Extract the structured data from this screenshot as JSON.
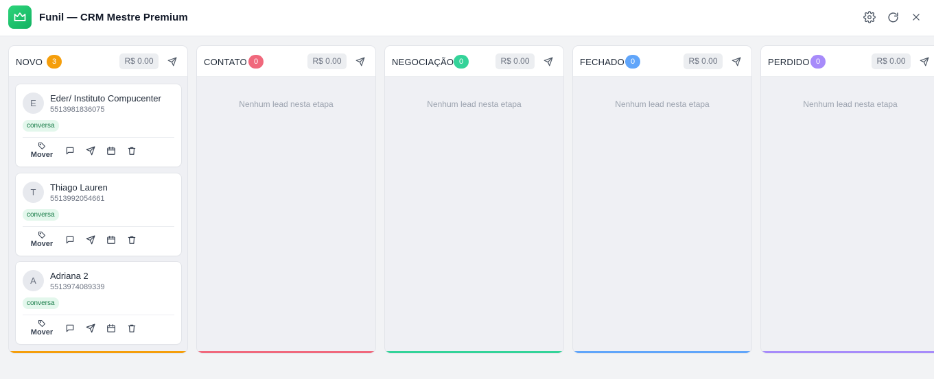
{
  "window": {
    "title": "Funil — CRM Mestre Premium",
    "icons": [
      "crown-icon",
      "settings-icon",
      "refresh-icon",
      "close-icon"
    ]
  },
  "columns": [
    {
      "name": "NOVO",
      "count": "3",
      "value": "R$ 0.00",
      "color": "#f59e0b",
      "leads": [
        {
          "initial": "E",
          "name": "Eder/ Instituto Compucenter",
          "phone": "5513981836075",
          "tag": "conversa",
          "move_label": "Mover"
        },
        {
          "initial": "T",
          "name": "Thiago Lauren",
          "phone": "5513992054661",
          "tag": "conversa",
          "move_label": "Mover"
        },
        {
          "initial": "A",
          "name": "Adriana 2",
          "phone": "5513974089339",
          "tag": "conversa",
          "move_label": "Mover"
        }
      ]
    },
    {
      "name": "CONTATO",
      "count": "0",
      "value": "R$ 0.00",
      "color": "#f0687c",
      "empty_text": "Nenhum lead nesta etapa"
    },
    {
      "name": "NEGOCIAÇÃO",
      "count": "0",
      "value": "R$ 0.00",
      "color": "#34d399",
      "empty_text": "Nenhum lead nesta etapa"
    },
    {
      "name": "FECHADO",
      "count": "0",
      "value": "R$ 0.00",
      "color": "#60a5fa",
      "empty_text": "Nenhum lead nesta etapa"
    },
    {
      "name": "PERDIDO",
      "count": "0",
      "value": "R$ 0.00",
      "color": "#a78bfa",
      "empty_text": "Nenhum lead nesta etapa"
    }
  ]
}
